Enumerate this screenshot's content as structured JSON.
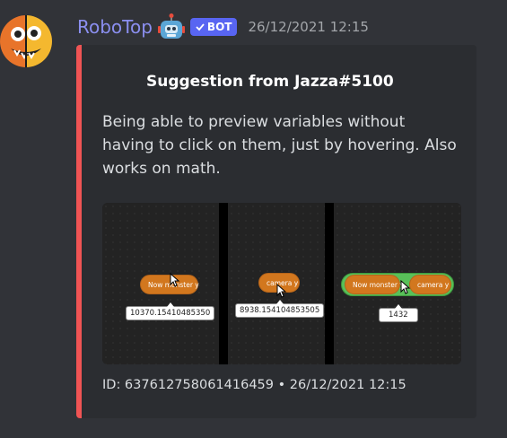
{
  "message": {
    "author": "RoboTop",
    "badge": "BOT",
    "timestamp": "26/12/2021 12:15",
    "avatar_icon": "robotop-avatar-icon",
    "emoji_icon": "robot-face-emoji"
  },
  "embed": {
    "accent_color": "#f05454",
    "title": "Suggestion from Jazza#5100",
    "description": "Being able to preview variables without having to click on them, just by hovering. Also works on math.",
    "image": {
      "panels": [
        {
          "block_label": "Now monster y",
          "tooltip": "10370.15410485350"
        },
        {
          "block_label": "camera y",
          "tooltip": "8938.154104853505"
        },
        {
          "block_left": "Now monster y",
          "block_right": "camera y",
          "tooltip": "1432"
        }
      ]
    },
    "footer": "ID: 637612758061416459 • 26/12/2021 12:15"
  }
}
